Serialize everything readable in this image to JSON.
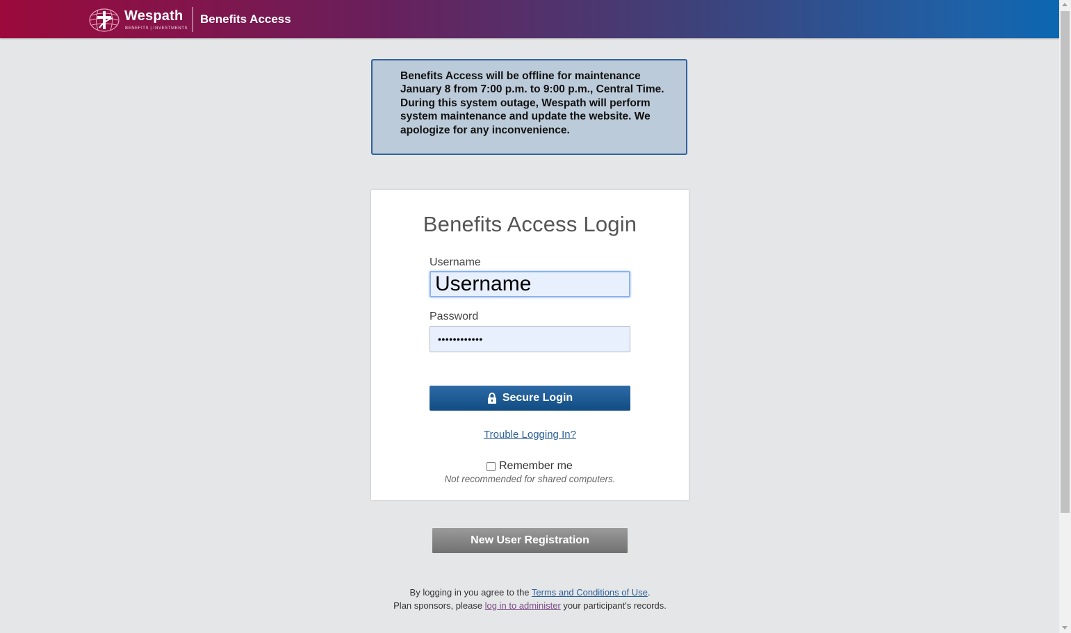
{
  "header": {
    "logo_name": "Wespath",
    "logo_tagline": "BENEFITS | INVESTMENTS",
    "app_title": "Benefits Access"
  },
  "notice": {
    "text": "Benefits Access will be offline for maintenance January 8 from 7:00 p.m. to 9:00 p.m., Central Time. During this system outage, Wespath will perform system maintenance and update the website. We apologize for any inconvenience."
  },
  "login": {
    "title": "Benefits Access Login",
    "username_label": "Username",
    "username_placeholder": "Username",
    "username_value": "",
    "password_label": "Password",
    "password_value": "••••••••••••",
    "secure_login_label": "Secure Login",
    "trouble_link": "Trouble Logging In?",
    "remember_label": "Remember me",
    "remember_checked": false,
    "remember_note": "Not recommended for shared computers."
  },
  "register": {
    "label": "New User Registration"
  },
  "footer": {
    "line1_prefix": "By logging in you agree to the ",
    "terms_link": "Terms and Conditions of Use",
    "line1_suffix": ".",
    "line2_prefix": "Plan sponsors, please ",
    "admin_link": "log in to administer",
    "line2_suffix": " your participant's records."
  },
  "colors": {
    "header_start": "#9b0a3b",
    "header_end": "#0b66b1",
    "primary_button": "#1a5a92",
    "notice_bg": "#bccbd9",
    "notice_border": "#2f62a0",
    "link": "#2a5f9a"
  }
}
